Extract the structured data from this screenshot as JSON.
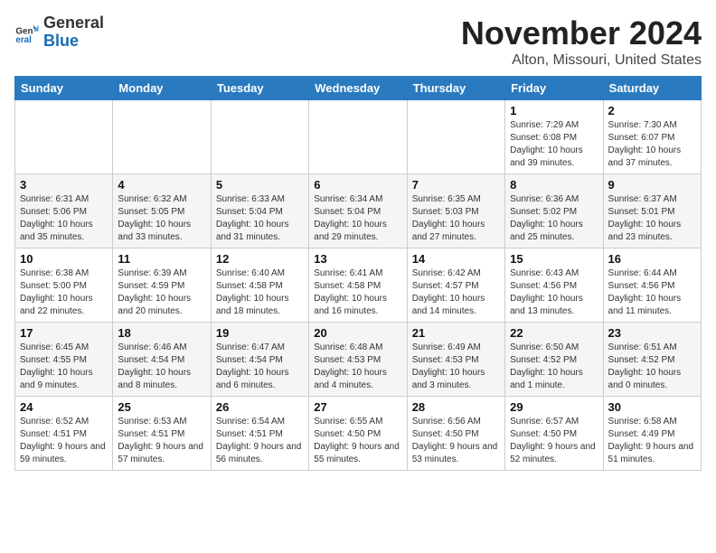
{
  "header": {
    "logo_line1": "General",
    "logo_line2": "Blue",
    "month": "November 2024",
    "location": "Alton, Missouri, United States"
  },
  "weekdays": [
    "Sunday",
    "Monday",
    "Tuesday",
    "Wednesday",
    "Thursday",
    "Friday",
    "Saturday"
  ],
  "weeks": [
    [
      {
        "day": "",
        "info": ""
      },
      {
        "day": "",
        "info": ""
      },
      {
        "day": "",
        "info": ""
      },
      {
        "day": "",
        "info": ""
      },
      {
        "day": "",
        "info": ""
      },
      {
        "day": "1",
        "info": "Sunrise: 7:29 AM\nSunset: 6:08 PM\nDaylight: 10 hours and 39 minutes."
      },
      {
        "day": "2",
        "info": "Sunrise: 7:30 AM\nSunset: 6:07 PM\nDaylight: 10 hours and 37 minutes."
      }
    ],
    [
      {
        "day": "3",
        "info": "Sunrise: 6:31 AM\nSunset: 5:06 PM\nDaylight: 10 hours and 35 minutes."
      },
      {
        "day": "4",
        "info": "Sunrise: 6:32 AM\nSunset: 5:05 PM\nDaylight: 10 hours and 33 minutes."
      },
      {
        "day": "5",
        "info": "Sunrise: 6:33 AM\nSunset: 5:04 PM\nDaylight: 10 hours and 31 minutes."
      },
      {
        "day": "6",
        "info": "Sunrise: 6:34 AM\nSunset: 5:04 PM\nDaylight: 10 hours and 29 minutes."
      },
      {
        "day": "7",
        "info": "Sunrise: 6:35 AM\nSunset: 5:03 PM\nDaylight: 10 hours and 27 minutes."
      },
      {
        "day": "8",
        "info": "Sunrise: 6:36 AM\nSunset: 5:02 PM\nDaylight: 10 hours and 25 minutes."
      },
      {
        "day": "9",
        "info": "Sunrise: 6:37 AM\nSunset: 5:01 PM\nDaylight: 10 hours and 23 minutes."
      }
    ],
    [
      {
        "day": "10",
        "info": "Sunrise: 6:38 AM\nSunset: 5:00 PM\nDaylight: 10 hours and 22 minutes."
      },
      {
        "day": "11",
        "info": "Sunrise: 6:39 AM\nSunset: 4:59 PM\nDaylight: 10 hours and 20 minutes."
      },
      {
        "day": "12",
        "info": "Sunrise: 6:40 AM\nSunset: 4:58 PM\nDaylight: 10 hours and 18 minutes."
      },
      {
        "day": "13",
        "info": "Sunrise: 6:41 AM\nSunset: 4:58 PM\nDaylight: 10 hours and 16 minutes."
      },
      {
        "day": "14",
        "info": "Sunrise: 6:42 AM\nSunset: 4:57 PM\nDaylight: 10 hours and 14 minutes."
      },
      {
        "day": "15",
        "info": "Sunrise: 6:43 AM\nSunset: 4:56 PM\nDaylight: 10 hours and 13 minutes."
      },
      {
        "day": "16",
        "info": "Sunrise: 6:44 AM\nSunset: 4:56 PM\nDaylight: 10 hours and 11 minutes."
      }
    ],
    [
      {
        "day": "17",
        "info": "Sunrise: 6:45 AM\nSunset: 4:55 PM\nDaylight: 10 hours and 9 minutes."
      },
      {
        "day": "18",
        "info": "Sunrise: 6:46 AM\nSunset: 4:54 PM\nDaylight: 10 hours and 8 minutes."
      },
      {
        "day": "19",
        "info": "Sunrise: 6:47 AM\nSunset: 4:54 PM\nDaylight: 10 hours and 6 minutes."
      },
      {
        "day": "20",
        "info": "Sunrise: 6:48 AM\nSunset: 4:53 PM\nDaylight: 10 hours and 4 minutes."
      },
      {
        "day": "21",
        "info": "Sunrise: 6:49 AM\nSunset: 4:53 PM\nDaylight: 10 hours and 3 minutes."
      },
      {
        "day": "22",
        "info": "Sunrise: 6:50 AM\nSunset: 4:52 PM\nDaylight: 10 hours and 1 minute."
      },
      {
        "day": "23",
        "info": "Sunrise: 6:51 AM\nSunset: 4:52 PM\nDaylight: 10 hours and 0 minutes."
      }
    ],
    [
      {
        "day": "24",
        "info": "Sunrise: 6:52 AM\nSunset: 4:51 PM\nDaylight: 9 hours and 59 minutes."
      },
      {
        "day": "25",
        "info": "Sunrise: 6:53 AM\nSunset: 4:51 PM\nDaylight: 9 hours and 57 minutes."
      },
      {
        "day": "26",
        "info": "Sunrise: 6:54 AM\nSunset: 4:51 PM\nDaylight: 9 hours and 56 minutes."
      },
      {
        "day": "27",
        "info": "Sunrise: 6:55 AM\nSunset: 4:50 PM\nDaylight: 9 hours and 55 minutes."
      },
      {
        "day": "28",
        "info": "Sunrise: 6:56 AM\nSunset: 4:50 PM\nDaylight: 9 hours and 53 minutes."
      },
      {
        "day": "29",
        "info": "Sunrise: 6:57 AM\nSunset: 4:50 PM\nDaylight: 9 hours and 52 minutes."
      },
      {
        "day": "30",
        "info": "Sunrise: 6:58 AM\nSunset: 4:49 PM\nDaylight: 9 hours and 51 minutes."
      }
    ]
  ]
}
